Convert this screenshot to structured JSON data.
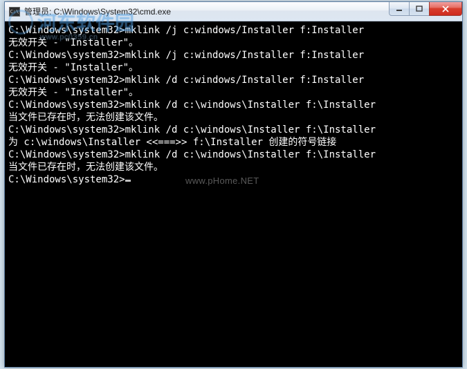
{
  "window": {
    "title": "管理员: C:\\Windows\\System32\\cmd.exe",
    "icon_label": "C:\\"
  },
  "terminal": {
    "lines": [
      "C:\\Windows\\system32>mklink /j c:windows/Installer f:Installer",
      "无效开关 - \"Installer\"。",
      "",
      "C:\\Windows\\system32>mklink /j c:windows/Installer f:Installer",
      "无效开关 - \"Installer\"。",
      "",
      "C:\\Windows\\system32>mklink /d c:windows/Installer f:Installer",
      "无效开关 - \"Installer\"。",
      "",
      "C:\\Windows\\system32>mklink /d c:\\windows\\Installer f:\\Installer",
      "当文件已存在时，无法创建该文件。",
      "",
      "C:\\Windows\\system32>mklink /d c:\\windows\\Installer f:\\Installer",
      "为 c:\\windows\\Installer <<===>> f:\\Installer 创建的符号链接",
      "",
      "C:\\Windows\\system32>mklink /d c:\\windows\\Installer f:\\Installer",
      "当文件已存在时，无法创建该文件。",
      "",
      "C:\\Windows\\system32>"
    ],
    "prompt_cursor": true
  },
  "watermarks": {
    "wm1_main": "河东软件园",
    "wm1_sub": "www.pc0359.cn",
    "wm2": "www.pHome.NET"
  }
}
